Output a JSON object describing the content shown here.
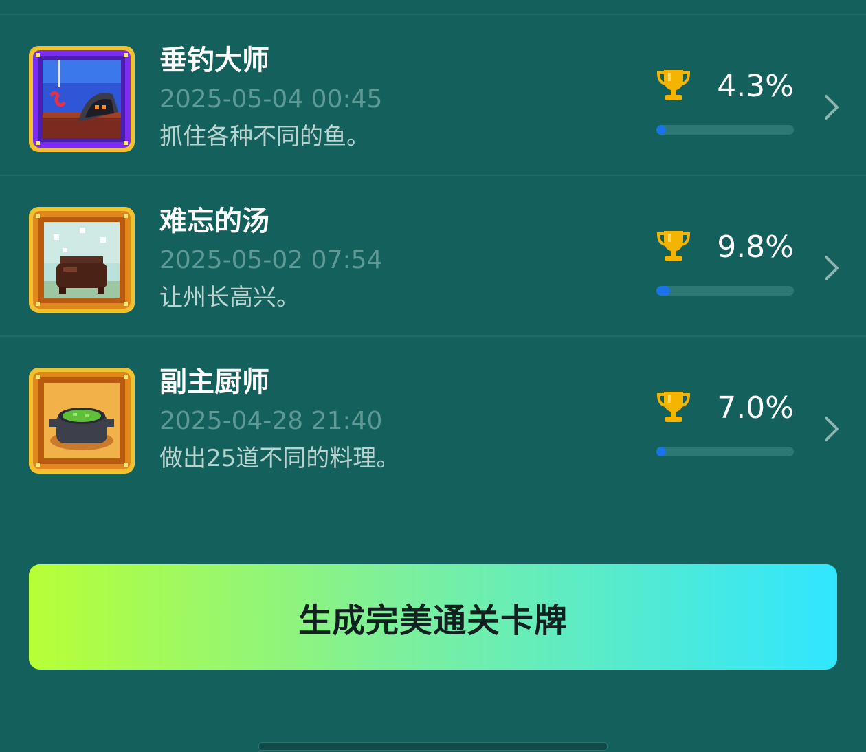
{
  "achievements": [
    {
      "title": "垂钓大师",
      "date": "2025-05-04 00:45",
      "description": "抓住各种不同的鱼。",
      "percent_label": "4.3%",
      "percent": 4.3,
      "badge_icon": "fishing-master-badge-icon",
      "frame_color": "#7b2df0"
    },
    {
      "title": "难忘的汤",
      "date": "2025-05-02 07:54",
      "description": "让州长高兴。",
      "percent_label": "9.8%",
      "percent": 9.8,
      "badge_icon": "memorable-soup-badge-icon",
      "frame_color": "#e0881c"
    },
    {
      "title": "副主厨师",
      "date": "2025-04-28 21:40",
      "description": "做出25道不同的料理。",
      "percent_label": "7.0%",
      "percent": 7.0,
      "badge_icon": "sous-chef-badge-icon",
      "frame_color": "#e0881c"
    }
  ],
  "generate_button": {
    "label": "生成完美通关卡牌"
  },
  "colors": {
    "background": "#14605c",
    "progress": "#1a73e8",
    "trophy": "#f5b400",
    "button_gradient": [
      "#b7ff36",
      "#7ef09a",
      "#30e6ff"
    ]
  }
}
